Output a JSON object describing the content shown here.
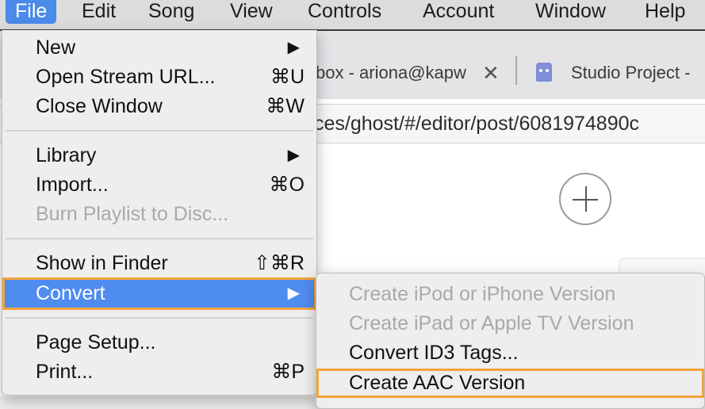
{
  "menubar": {
    "items": [
      "File",
      "Edit",
      "Song",
      "View",
      "Controls",
      "Account",
      "Window",
      "Help"
    ]
  },
  "browser": {
    "tab1_title": "box - ariona@kapw",
    "tab1_close": "✕",
    "tab2_title": "Studio Project -",
    "url": "ces/ghost/#/editor/post/6081974890c"
  },
  "file_menu": {
    "new": {
      "label": "New",
      "arrow": "▶"
    },
    "open_stream": {
      "label": "Open Stream URL...",
      "shortcut": "⌘U"
    },
    "close_window": {
      "label": "Close Window",
      "shortcut": "⌘W"
    },
    "library": {
      "label": "Library",
      "arrow": "▶"
    },
    "import": {
      "label": "Import...",
      "shortcut": "⌘O"
    },
    "burn": {
      "label": "Burn Playlist to Disc..."
    },
    "show_finder": {
      "label": "Show in Finder",
      "shortcut": "⇧⌘R"
    },
    "convert": {
      "label": "Convert",
      "arrow": "▶"
    },
    "page_setup": {
      "label": "Page Setup..."
    },
    "print": {
      "label": "Print...",
      "shortcut": "⌘P"
    }
  },
  "convert_submenu": {
    "ipod": "Create iPod or iPhone Version",
    "ipad": "Create iPad or Apple TV Version",
    "id3": "Convert ID3 Tags...",
    "aac": "Create AAC Version"
  },
  "colors": {
    "highlight": "#4f8cf0",
    "callout": "#f2a43a",
    "menu_bg": "#eeeeee",
    "disabled_text": "#a9a9a9"
  }
}
